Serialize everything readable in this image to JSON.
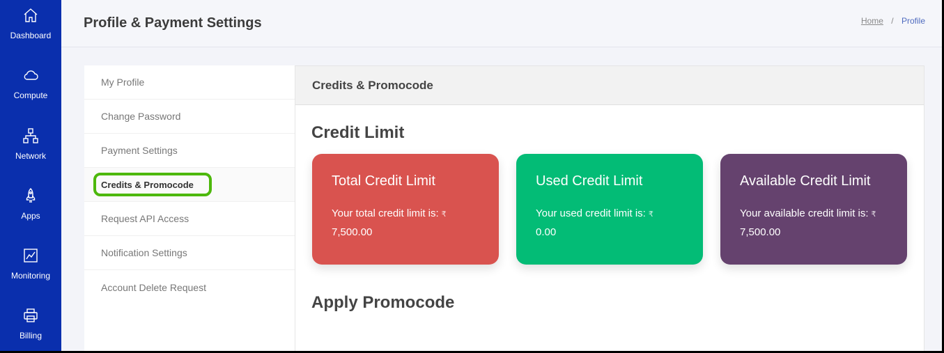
{
  "sidenav": {
    "items": [
      {
        "label": "Dashboard",
        "icon": "home-icon"
      },
      {
        "label": "Compute",
        "icon": "cloud-icon"
      },
      {
        "label": "Network",
        "icon": "network-icon"
      },
      {
        "label": "Apps",
        "icon": "rocket-icon"
      },
      {
        "label": "Monitoring",
        "icon": "chart-icon"
      },
      {
        "label": "Billing",
        "icon": "printer-icon"
      }
    ]
  },
  "header": {
    "title": "Profile & Payment Settings",
    "breadcrumb": {
      "home": "Home",
      "separator": "/",
      "current": "Profile"
    }
  },
  "menu": {
    "items": [
      {
        "label": "My Profile"
      },
      {
        "label": "Change Password"
      },
      {
        "label": "Payment Settings"
      },
      {
        "label": "Credits & Promocode",
        "active": true
      },
      {
        "label": "Request API Access"
      },
      {
        "label": "Notification Settings"
      },
      {
        "label": "Account Delete Request"
      }
    ]
  },
  "panel": {
    "heading": "Credits & Promocode",
    "credit_section_title": "Credit Limit",
    "promo_section_title": "Apply Promocode",
    "currency_symbol": "₹",
    "cards": [
      {
        "title": "Total Credit Limit",
        "text": "Your total credit limit is:",
        "amount": "7,500.00",
        "color": "#d9534f"
      },
      {
        "title": "Used Credit Limit",
        "text": "Your used credit limit is:",
        "amount": "0.00",
        "color": "#03bc76"
      },
      {
        "title": "Available Credit Limit",
        "text": "Your available credit limit is:",
        "amount": "7,500.00",
        "color": "#65426e"
      }
    ]
  },
  "colors": {
    "sidebar": "#0a2fad",
    "highlight": "#4db80c"
  }
}
